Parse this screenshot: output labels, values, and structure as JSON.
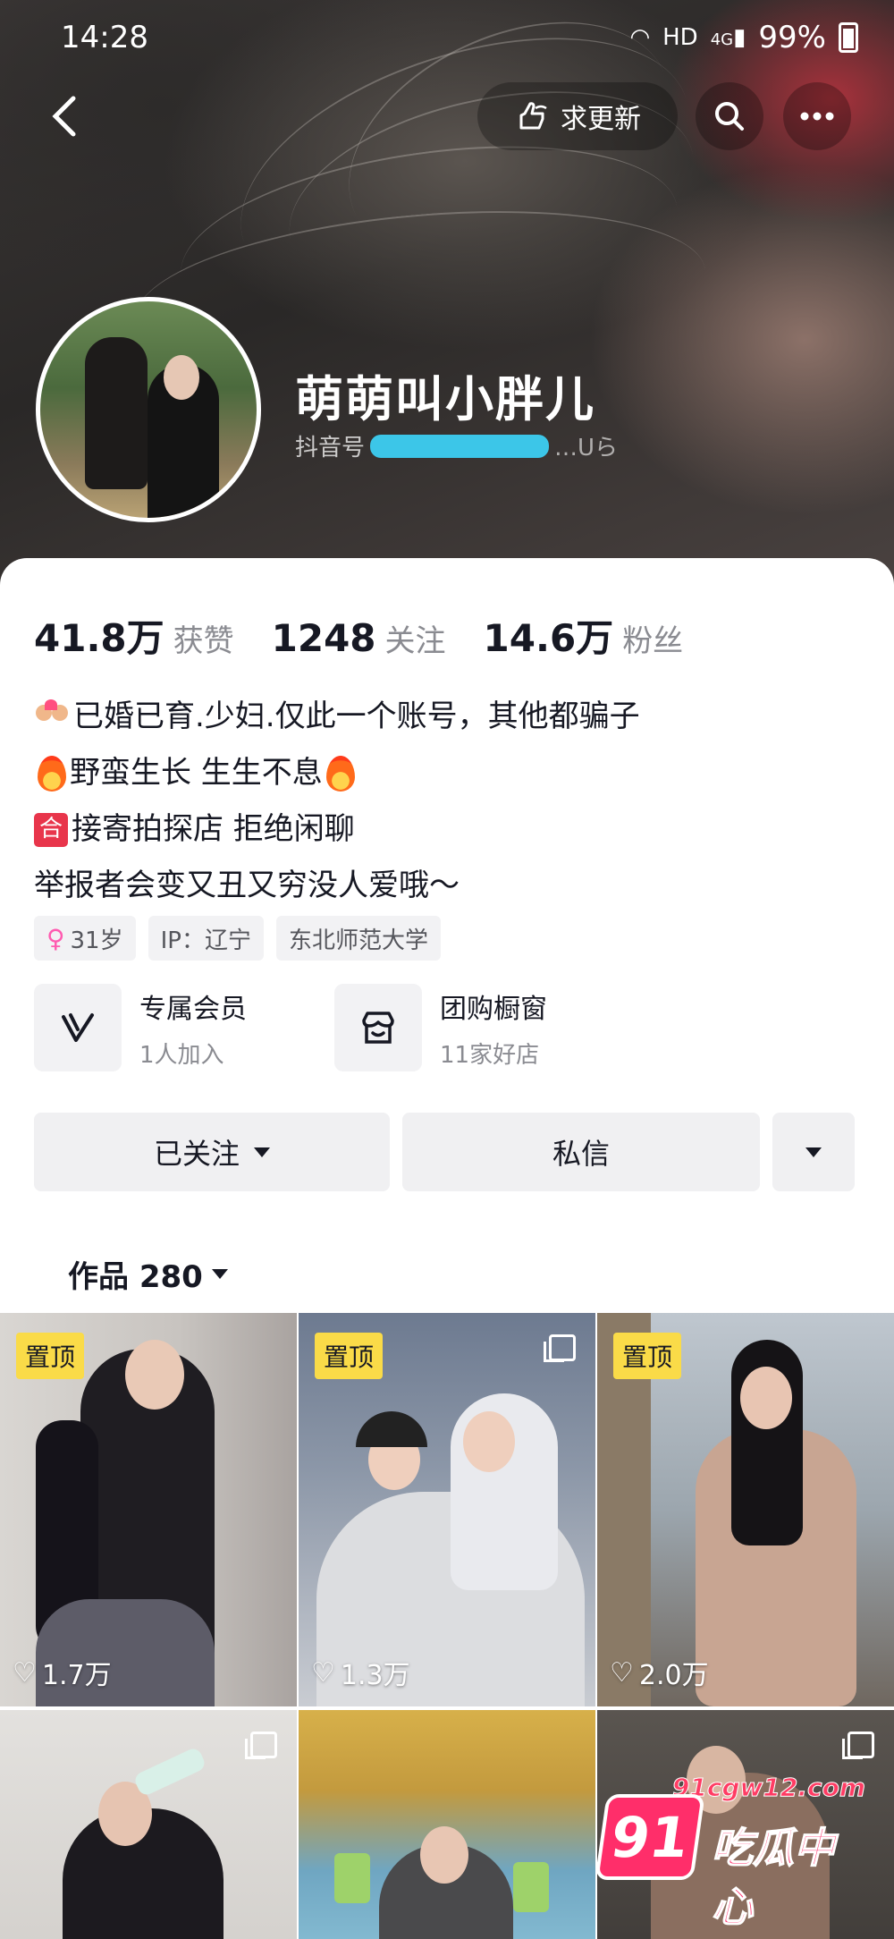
{
  "status_bar": {
    "time": "14:28",
    "network": "HD",
    "signal": "4G",
    "battery": "99%"
  },
  "header": {
    "update_label": "求更新"
  },
  "profile": {
    "nickname": "萌萌叫小胖儿",
    "id_prefix": "抖音号",
    "id_suffix": "…Uら"
  },
  "stats": [
    {
      "num": "41.8万",
      "label": "获赞"
    },
    {
      "num": "1248",
      "label": "关注"
    },
    {
      "num": "14.6万",
      "label": "粉丝"
    }
  ],
  "bio": {
    "line1": "已婚已育.少妇.仅此一个账号，其他都骗子",
    "line2": "野蛮生长 生生不息",
    "line3_badge": "合",
    "line3": "接寄拍探店 拒绝闲聊",
    "line4": "举报者会变又丑又穷没人爱哦～"
  },
  "tags": {
    "age": "31岁",
    "ip": "IP：辽宁",
    "school": "东北师范大学"
  },
  "services": [
    {
      "title": "专属会员",
      "sub": "1人加入",
      "icon": "v-membership-icon"
    },
    {
      "title": "团购橱窗",
      "sub": "11家好店",
      "icon": "shop-window-icon"
    }
  ],
  "actions": {
    "follow": "已关注",
    "message": "私信"
  },
  "works": {
    "label": "作品 280"
  },
  "posts": [
    {
      "pinned": "置顶",
      "likes": "1.7万",
      "multi": false
    },
    {
      "pinned": "置顶",
      "likes": "1.3万",
      "multi": true
    },
    {
      "pinned": "置顶",
      "likes": "2.0万",
      "multi": false
    },
    {
      "pinned": "",
      "likes": "",
      "multi": true
    },
    {
      "pinned": "",
      "likes": "",
      "multi": false
    },
    {
      "pinned": "",
      "likes": "",
      "multi": true
    }
  ],
  "watermark": {
    "url": "91cgw12.com",
    "logo": "91",
    "text": "吃瓜中心"
  },
  "colors": {
    "accent_pin": "#fadb48",
    "watermark": "#ff2e6a",
    "redaction": "#3cc6e8"
  }
}
